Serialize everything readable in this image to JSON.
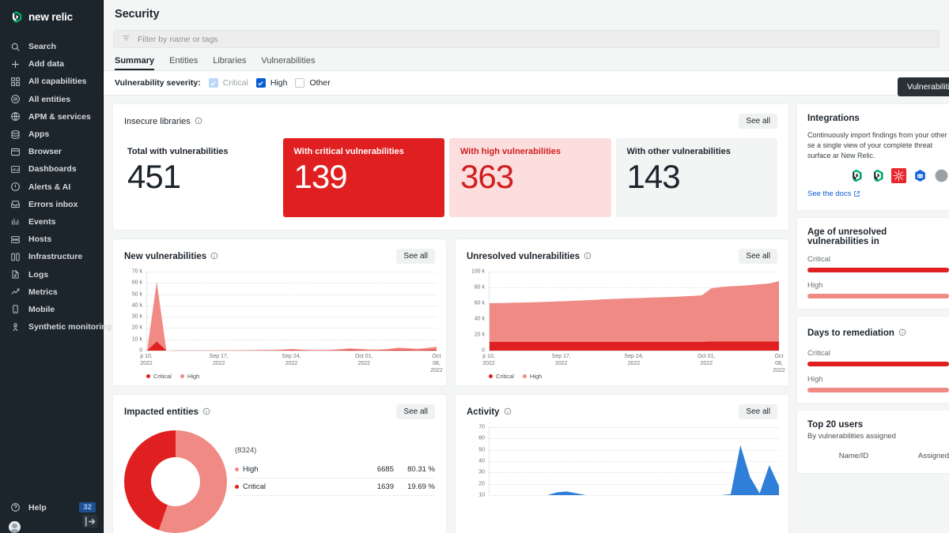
{
  "sidebar": {
    "brand": "new relic",
    "items": [
      {
        "label": "Search",
        "icon": "search-icon"
      },
      {
        "label": "Add data",
        "icon": "plus-icon"
      },
      {
        "label": "All capabilities",
        "icon": "grid-icon"
      },
      {
        "label": "All entities",
        "icon": "hexagon-icon"
      },
      {
        "label": "APM & services",
        "icon": "globe-icon"
      },
      {
        "label": "Apps",
        "icon": "stack-icon"
      },
      {
        "label": "Browser",
        "icon": "window-icon"
      },
      {
        "label": "Dashboards",
        "icon": "dashboard-icon"
      },
      {
        "label": "Alerts & AI",
        "icon": "alert-icon"
      },
      {
        "label": "Errors inbox",
        "icon": "inbox-icon"
      },
      {
        "label": "Events",
        "icon": "bars-icon"
      },
      {
        "label": "Hosts",
        "icon": "server-icon"
      },
      {
        "label": "Infrastructure",
        "icon": "columns-icon"
      },
      {
        "label": "Logs",
        "icon": "document-icon"
      },
      {
        "label": "Metrics",
        "icon": "chart-line-icon"
      },
      {
        "label": "Mobile",
        "icon": "phone-icon"
      },
      {
        "label": "Synthetic monitoring",
        "icon": "person-icon"
      }
    ],
    "help": {
      "label": "Help",
      "badge": "32",
      "icon": "help-icon"
    },
    "collapse_icon": "collapse-panel-icon"
  },
  "header": {
    "title": "Security"
  },
  "search": {
    "placeholder": "Filter by name or tags",
    "icon": "filter-icon"
  },
  "tabs": [
    {
      "label": "Summary",
      "active": true
    },
    {
      "label": "Entities",
      "active": false
    },
    {
      "label": "Libraries",
      "active": false
    },
    {
      "label": "Vulnerabilities",
      "active": false
    }
  ],
  "severity_filter": {
    "label": "Vulnerability severity:",
    "options": [
      {
        "label": "Critical",
        "checked": true,
        "disabled": true
      },
      {
        "label": "High",
        "checked": true,
        "disabled": false
      },
      {
        "label": "Other",
        "checked": false,
        "disabled": false
      }
    ]
  },
  "vulnerabilities_button": "Vulnerabilities",
  "see_all_label": "See all",
  "insecure_libraries": {
    "title": "Insecure libraries",
    "stats": [
      {
        "label": "Total with vulnerabilities",
        "value": "451",
        "style": "plain"
      },
      {
        "label": "With critical vulnerabilities",
        "value": "139",
        "style": "critical"
      },
      {
        "label": "With high vulnerabilities",
        "value": "363",
        "style": "high"
      },
      {
        "label": "With other vulnerabilities",
        "value": "143",
        "style": "other"
      }
    ]
  },
  "new_vulnerabilities": {
    "title": "New vulnerabilities"
  },
  "unresolved_vulnerabilities": {
    "title": "Unresolved vulnerabilities"
  },
  "impacted_entities": {
    "title": "Impacted entities",
    "total": "(8324)",
    "rows": [
      {
        "name": "High",
        "count": "6685",
        "pct": "80.31 %",
        "color": "#f08a85"
      },
      {
        "name": "Critical",
        "count": "1639",
        "pct": "19.69 %",
        "color": "#e02020"
      }
    ]
  },
  "activity": {
    "title": "Activity"
  },
  "integrations": {
    "title": "Integrations",
    "description": "Continuously import findings from your other se a single view of your complete threat surface ar New Relic.",
    "docs_link": "See the docs",
    "icons": [
      "github-icon",
      "github-icon",
      "snyk-icon",
      "lacework-icon",
      "generic-icon"
    ]
  },
  "age_unresolved": {
    "title": "Age of unresolved vulnerabilities in",
    "rows": [
      {
        "label": "Critical",
        "color": "#e02020"
      },
      {
        "label": "High",
        "color": "#f08a85"
      }
    ]
  },
  "days_to_remediation": {
    "title": "Days to remediation",
    "rows": [
      {
        "label": "Critical",
        "color": "#e02020"
      },
      {
        "label": "High",
        "color": "#f08a85"
      }
    ]
  },
  "top_users": {
    "title": "Top 20 users",
    "subtitle": "By vulnerabilities assigned",
    "columns": [
      "Name/ID",
      "Assigned"
    ]
  },
  "chart_data": [
    {
      "type": "area",
      "name": "new_vulnerabilities",
      "title": "New vulnerabilities",
      "xlabel": "",
      "ylabel": "",
      "ylim": [
        0,
        70000
      ],
      "yticks": [
        "0",
        "10 k",
        "20 k",
        "30 k",
        "40 k",
        "50 k",
        "60 k",
        "70 k"
      ],
      "xticks": [
        "p 10,\n2022",
        "Sep 17,\n2022",
        "Sep 24,\n2022",
        "Oct 01,\n2022",
        "Oct 08,\n2022"
      ],
      "grid": true,
      "legend": [
        "Critical",
        "High"
      ],
      "legend_position": "bottom-left",
      "series": [
        {
          "name": "High",
          "color": "#f08a85",
          "values": [
            0,
            61000,
            0,
            200,
            150,
            180,
            200,
            220,
            260,
            300,
            350,
            400,
            500,
            600,
            900,
            1400,
            900,
            600,
            500,
            700,
            1200,
            2000,
            1500,
            1000,
            900,
            1400,
            2600,
            2200,
            1600,
            2400,
            3400
          ]
        },
        {
          "name": "Critical",
          "color": "#e02020",
          "values": [
            0,
            8000,
            0,
            60,
            50,
            60,
            70,
            70,
            80,
            90,
            110,
            120,
            150,
            180,
            250,
            400,
            260,
            180,
            150,
            200,
            350,
            600,
            450,
            300,
            260,
            400,
            700,
            600,
            450,
            650,
            900
          ]
        }
      ]
    },
    {
      "type": "area",
      "name": "unresolved_vulnerabilities",
      "title": "Unresolved vulnerabilities",
      "xlabel": "",
      "ylabel": "",
      "ylim": [
        0,
        100000
      ],
      "yticks": [
        "0",
        "20 k",
        "40 k",
        "60 k",
        "80 k",
        "100 k"
      ],
      "xticks": [
        "p 10,\n2022",
        "Sep 17,\n2022",
        "Sep 24,\n2022",
        "Oct 01,\n2022",
        "Oct 08,\n2022"
      ],
      "grid": true,
      "legend": [
        "Critical",
        "High"
      ],
      "legend_position": "bottom-left",
      "series": [
        {
          "name": "High",
          "color": "#f08a85",
          "values": [
            60000,
            60200,
            60500,
            60800,
            61000,
            61400,
            61800,
            62200,
            62600,
            63200,
            63800,
            64400,
            65000,
            65500,
            66000,
            66400,
            66800,
            67200,
            67600,
            68000,
            68600,
            69200,
            70000,
            79000,
            80500,
            81500,
            82000,
            83000,
            84000,
            85000,
            88000
          ]
        },
        {
          "name": "Critical",
          "color": "#e02020",
          "values": [
            11000,
            11000,
            11000,
            11000,
            11000,
            11000,
            11000,
            11000,
            11000,
            11000,
            11000,
            11000,
            11000,
            11000,
            11000,
            11000,
            11000,
            11000,
            11000,
            11000,
            11000,
            11000,
            11000,
            11500,
            11500,
            11500,
            11500,
            11500,
            11500,
            11500,
            11500
          ]
        }
      ]
    },
    {
      "type": "pie",
      "name": "impacted_entities",
      "title": "Impacted entities",
      "total": 8324,
      "labels": [
        "High",
        "Critical"
      ],
      "values": [
        6685,
        1639
      ],
      "percents": [
        80.31,
        19.69
      ],
      "colors": [
        "#f08a85",
        "#e02020"
      ]
    },
    {
      "type": "area",
      "name": "activity",
      "title": "Activity",
      "xlabel": "",
      "ylabel": "",
      "ylim": [
        0,
        75
      ],
      "yticks": [
        "10",
        "20",
        "30",
        "40",
        "50",
        "60",
        "70"
      ],
      "grid": true,
      "series": [
        {
          "name": "Activity",
          "color": "#2f7ed8",
          "values": [
            0,
            0,
            0,
            0,
            0,
            0,
            0,
            3,
            4,
            2,
            0,
            0,
            0,
            0,
            0,
            0,
            0,
            0,
            0,
            0,
            0,
            0,
            0,
            0,
            0,
            1,
            55,
            20,
            2,
            33,
            10
          ]
        }
      ]
    }
  ]
}
